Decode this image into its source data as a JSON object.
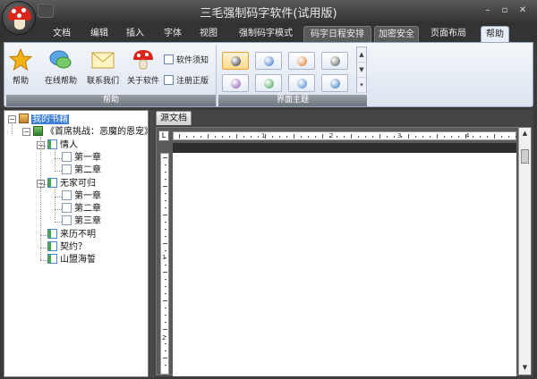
{
  "window": {
    "title": "三毛强制码字软件(试用版)",
    "controls": {
      "minimize": "–",
      "restore": "▫",
      "close": "✕"
    }
  },
  "ribbon_tabs": [
    {
      "label": "文档",
      "state": "normal"
    },
    {
      "label": "编辑",
      "state": "normal"
    },
    {
      "label": "插入",
      "state": "normal"
    },
    {
      "label": "字体",
      "state": "normal"
    },
    {
      "label": "视图",
      "state": "normal"
    },
    {
      "label": "强制码字模式",
      "state": "normal"
    },
    {
      "label": "码字日程安排",
      "state": "contextual"
    },
    {
      "label": "加密安全",
      "state": "contextual"
    },
    {
      "label": "页面布局",
      "state": "normal"
    },
    {
      "label": "帮助",
      "state": "active"
    }
  ],
  "help_group": {
    "label": "帮助",
    "buttons": [
      {
        "label": "帮助",
        "icon": "star-icon"
      },
      {
        "label": "在线帮助",
        "icon": "chat-bubble-icon"
      },
      {
        "label": "联系我们",
        "icon": "envelope-icon"
      },
      {
        "label": "关于软件",
        "icon": "mushroom-icon"
      }
    ],
    "small_buttons": [
      {
        "label": "软件须知",
        "icon": "notice-icon"
      },
      {
        "label": "注册正版",
        "icon": "register-icon"
      }
    ]
  },
  "theme_group": {
    "label": "界面主题",
    "swatches": [
      {
        "color": "#2d2d2d",
        "selected": true
      },
      {
        "color": "#2f6fc4",
        "selected": false
      },
      {
        "color": "#d9731c",
        "selected": false
      },
      {
        "color": "#555555",
        "selected": false
      },
      {
        "color": "#8a4fb8",
        "selected": false
      },
      {
        "color": "#3aa04a",
        "selected": false
      },
      {
        "color": "#3a7ed0",
        "selected": false
      },
      {
        "color": "#2f6fc4",
        "selected": false
      }
    ]
  },
  "tree": {
    "root": "我的书籍",
    "book": "《首席挑战：恶魔的恩宠》",
    "parts": [
      {
        "title": "情人",
        "chapters": [
          "第一章",
          "第二章"
        ]
      },
      {
        "title": "无家可归",
        "chapters": [
          "第一章",
          "第二章",
          "第三章"
        ]
      },
      {
        "title": "来历不明",
        "chapters": []
      },
      {
        "title": "契约？",
        "chapters": []
      },
      {
        "title": "山盟海誓",
        "chapters": []
      }
    ]
  },
  "editor": {
    "tab_label": "源文档",
    "ruler_numbers": [
      "1",
      "2",
      "3",
      "4"
    ],
    "vruler_numbers": [
      "1",
      "2"
    ]
  }
}
